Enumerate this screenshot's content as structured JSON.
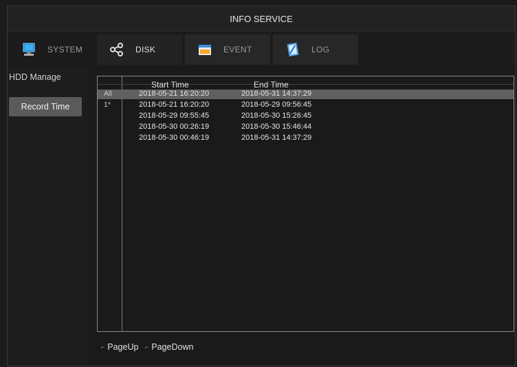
{
  "window": {
    "title": "INFO SERVICE"
  },
  "tabs": [
    {
      "label": "SYSTEM",
      "icon": "monitor-icon"
    },
    {
      "label": "DISK",
      "icon": "network-disk-icon"
    },
    {
      "label": "EVENT",
      "icon": "event-icon"
    },
    {
      "label": "LOG",
      "icon": "log-notebook-icon"
    }
  ],
  "sidebar": {
    "items": [
      {
        "label": "HDD Manage"
      },
      {
        "label": "Record Time"
      }
    ]
  },
  "table": {
    "columns": [
      "Start Time",
      "End Time"
    ],
    "rows": [
      {
        "index": "All",
        "start": "2018-05-21 16:20:20",
        "end": "2018-05-31 14:37:29"
      },
      {
        "index": "1*",
        "start": "2018-05-21 16:20:20",
        "end": "2018-05-29 09:56:45"
      },
      {
        "index": "",
        "start": "2018-05-29 09:55:45",
        "end": "2018-05-30 15:26:45"
      },
      {
        "index": "",
        "start": "2018-05-30 00:26:19",
        "end": "2018-05-30 15:46:44"
      },
      {
        "index": "",
        "start": "2018-05-30 00:46:19",
        "end": "2018-05-31 14:37:29"
      }
    ]
  },
  "pager": {
    "page_up": "PageUp",
    "page_down": "PageDown"
  },
  "colors": {
    "selected_row": "#606060",
    "selected_sidebar": "#5a5a5a",
    "background": "#1a1a1a"
  }
}
